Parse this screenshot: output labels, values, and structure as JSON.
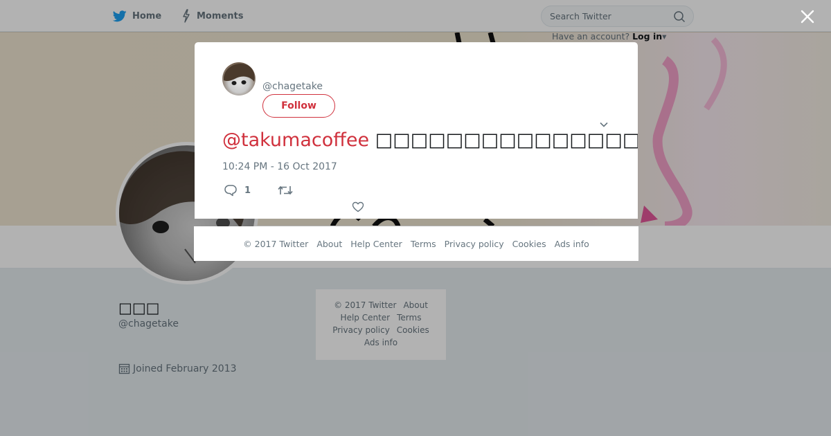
{
  "nav": {
    "home_label": "Home",
    "moments_label": "Moments",
    "search_placeholder": "Search Twitter",
    "have_account_text": "Have an account?",
    "login_label": "Log in"
  },
  "profile": {
    "display_name": "□□□",
    "screen_name": "@chagetake",
    "joined": "Joined February 2013"
  },
  "side_footer": {
    "copyright": "© 2017 Twitter",
    "about": "About",
    "help_center": "Help Center",
    "terms": "Terms",
    "privacy": "Privacy policy",
    "cookies": "Cookies",
    "ads_info": "Ads info"
  },
  "tweet": {
    "handle": "@chagetake",
    "follow_label": "Follow",
    "mention": "@takumacoffee",
    "text": "□□□□□□□□□□□□□□□□",
    "timestamp": "10:24 PM - 16 Oct 2017",
    "reply_count": "1"
  },
  "modal_footer": {
    "copyright": "© 2017 Twitter",
    "about": "About",
    "help_center": "Help Center",
    "terms": "Terms",
    "privacy": "Privacy policy",
    "cookies": "Cookies",
    "ads_info": "Ads info"
  },
  "colors": {
    "accent": "#d0313d",
    "text_secondary": "#66757f",
    "brand_bird": "#1da1f2"
  }
}
